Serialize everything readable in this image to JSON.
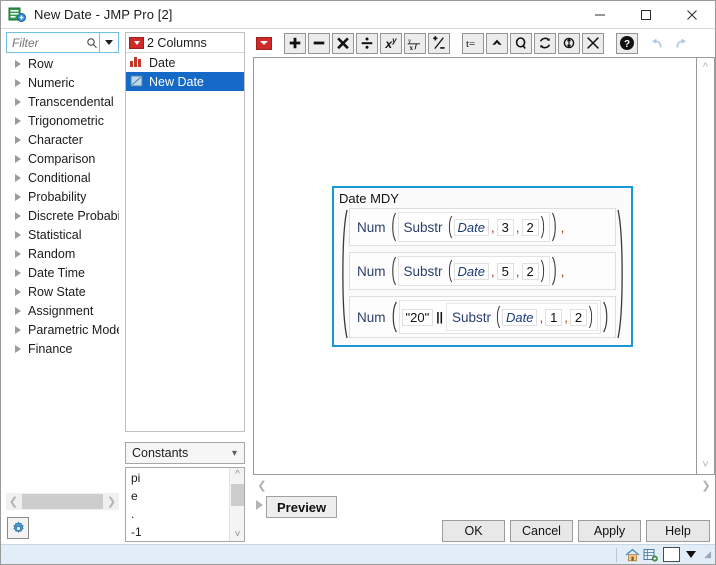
{
  "window": {
    "title": "New Date - JMP Pro [2]",
    "icon": "jmp-formula-column-icon",
    "controls": {
      "minimize": "minimize-icon",
      "maximize": "maximize-icon",
      "close": "close-icon"
    }
  },
  "filter": {
    "placeholder": "Filter",
    "value": "",
    "search_icon": "search-icon",
    "dropdown_icon": "chevron-down-icon"
  },
  "function_categories": [
    {
      "label": "Row"
    },
    {
      "label": "Numeric"
    },
    {
      "label": "Transcendental"
    },
    {
      "label": "Trigonometric"
    },
    {
      "label": "Character"
    },
    {
      "label": "Comparison"
    },
    {
      "label": "Conditional"
    },
    {
      "label": "Probability"
    },
    {
      "label": "Discrete Probabili"
    },
    {
      "label": "Statistical"
    },
    {
      "label": "Random"
    },
    {
      "label": "Date Time"
    },
    {
      "label": "Row State"
    },
    {
      "label": "Assignment"
    },
    {
      "label": "Parametric Mode"
    },
    {
      "label": "Finance"
    }
  ],
  "columns_panel": {
    "header": "2 Columns",
    "menu_icon": "red-triangle-menu-icon",
    "items": [
      {
        "label": "Date",
        "icon": "continuous-bar-icon",
        "selected": false
      },
      {
        "label": "New Date",
        "icon": "formula-column-icon",
        "selected": true
      }
    ]
  },
  "constants": {
    "selected": "Constants",
    "chevron": "chevron-down-icon",
    "items": [
      "pi",
      "e",
      ".",
      "-1"
    ]
  },
  "toolbar": {
    "menu_icon": "red-triangle-menu-icon",
    "buttons": [
      {
        "name": "add-button",
        "label": "+"
      },
      {
        "name": "subtract-button",
        "label": "−"
      },
      {
        "name": "multiply-button",
        "label": "✕"
      },
      {
        "name": "divide-button",
        "label": "÷"
      },
      {
        "name": "power-button",
        "label": "xʸ"
      },
      {
        "name": "root-button",
        "label": "ⁿ√x"
      },
      {
        "name": "sign-toggle-button",
        "label": "±"
      },
      {
        "name": "insert-text-button",
        "label": "t="
      },
      {
        "name": "peak-button",
        "label": "⌃"
      },
      {
        "name": "local-variable-button",
        "label": "Q"
      },
      {
        "name": "refresh-button",
        "label": "↺"
      },
      {
        "name": "swap-button",
        "label": "⇅"
      },
      {
        "name": "delete-button",
        "label": "✕"
      },
      {
        "name": "help-button",
        "label": "?"
      },
      {
        "name": "undo-button",
        "label": "↶"
      },
      {
        "name": "redo-button",
        "label": "↷"
      }
    ]
  },
  "formula": {
    "title": "Date MDY",
    "args": [
      {
        "outer_fn": "Num",
        "inner_fn": "Substr",
        "column": "Date",
        "arg1": "3",
        "arg2": "2",
        "prefix": "",
        "operator": "",
        "trailing_comma": ","
      },
      {
        "outer_fn": "Num",
        "inner_fn": "Substr",
        "column": "Date",
        "arg1": "5",
        "arg2": "2",
        "prefix": "",
        "operator": "",
        "trailing_comma": ","
      },
      {
        "outer_fn": "Num",
        "inner_fn": "Substr",
        "column": "Date",
        "arg1": "1",
        "arg2": "2",
        "prefix": "\"20\"",
        "operator": "||",
        "trailing_comma": ""
      }
    ],
    "separator": ",",
    "selection_color": "#1899d6"
  },
  "bottom": {
    "preview_label": "Preview",
    "preview_toggle": "expand-triangle-icon",
    "ok_label": "OK",
    "cancel_label": "Cancel",
    "apply_label": "Apply",
    "help_label": "Help"
  },
  "statusbar": {
    "home_icon": "home-icon",
    "table-icon": "data-table-icon",
    "color_swatch": "#ffffff",
    "dropdown_icon": "caret-down-icon",
    "resize_grip": "resize-grip-icon"
  },
  "colors": {
    "selection_blue": "#1569c7",
    "accent_blue": "#1899d6",
    "menu_red": "#cf2a27",
    "function_text": "#2b3f6b",
    "column_text": "#1b3a7a"
  }
}
